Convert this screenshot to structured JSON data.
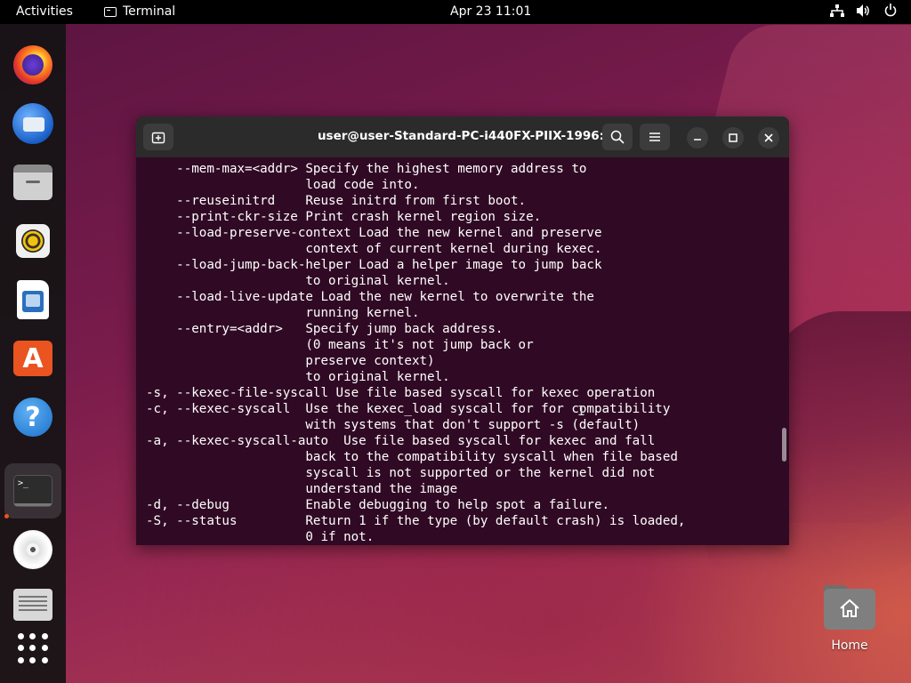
{
  "topbar": {
    "activities": "Activities",
    "app_name": "Terminal",
    "clock": "Apr 23  11:01"
  },
  "dock": {
    "items": [
      "firefox-icon",
      "thunderbird-icon",
      "files-icon",
      "rhythmbox-icon",
      "writer-icon",
      "app-center-icon",
      "help-icon",
      "terminal-icon",
      "dvd-icon",
      "text-editor-icon",
      "show-apps-icon"
    ]
  },
  "window": {
    "title": "user@user-Standard-PC-i440FX-PIIX-1996: ~"
  },
  "terminal": {
    "lines": [
      "    --mem-max=<addr> Specify the highest memory address to",
      "                     load code into.",
      "    --reuseinitrd    Reuse initrd from first boot.",
      "    --print-ckr-size Print crash kernel region size.",
      "    --load-preserve-context Load the new kernel and preserve",
      "                     context of current kernel during kexec.",
      "    --load-jump-back-helper Load a helper image to jump back",
      "                     to original kernel.",
      "    --load-live-update Load the new kernel to overwrite the",
      "                     running kernel.",
      "    --entry=<addr>   Specify jump back address.",
      "                     (0 means it's not jump back or",
      "                     preserve context)",
      "                     to original kernel.",
      "-s, --kexec-file-syscall Use file based syscall for kexec operation",
      "-c, --kexec-syscall  Use the kexec_load syscall for for compatibility",
      "                     with systems that don't support -s (default)",
      "-a, --kexec-syscall-auto  Use file based syscall for kexec and fall",
      "                     back to the compatibility syscall when file based",
      "                     syscall is not supported or the kernel did not",
      "                     understand the image",
      "-d, --debug          Enable debugging to help spot a failure.",
      "-S, --status         Return 1 if the type (by default crash) is loaded,",
      "                     0 if not."
    ]
  },
  "desktop": {
    "home_label": "Home"
  },
  "colors": {
    "terminal_bg": "#300a24",
    "accent": "#e95420"
  }
}
